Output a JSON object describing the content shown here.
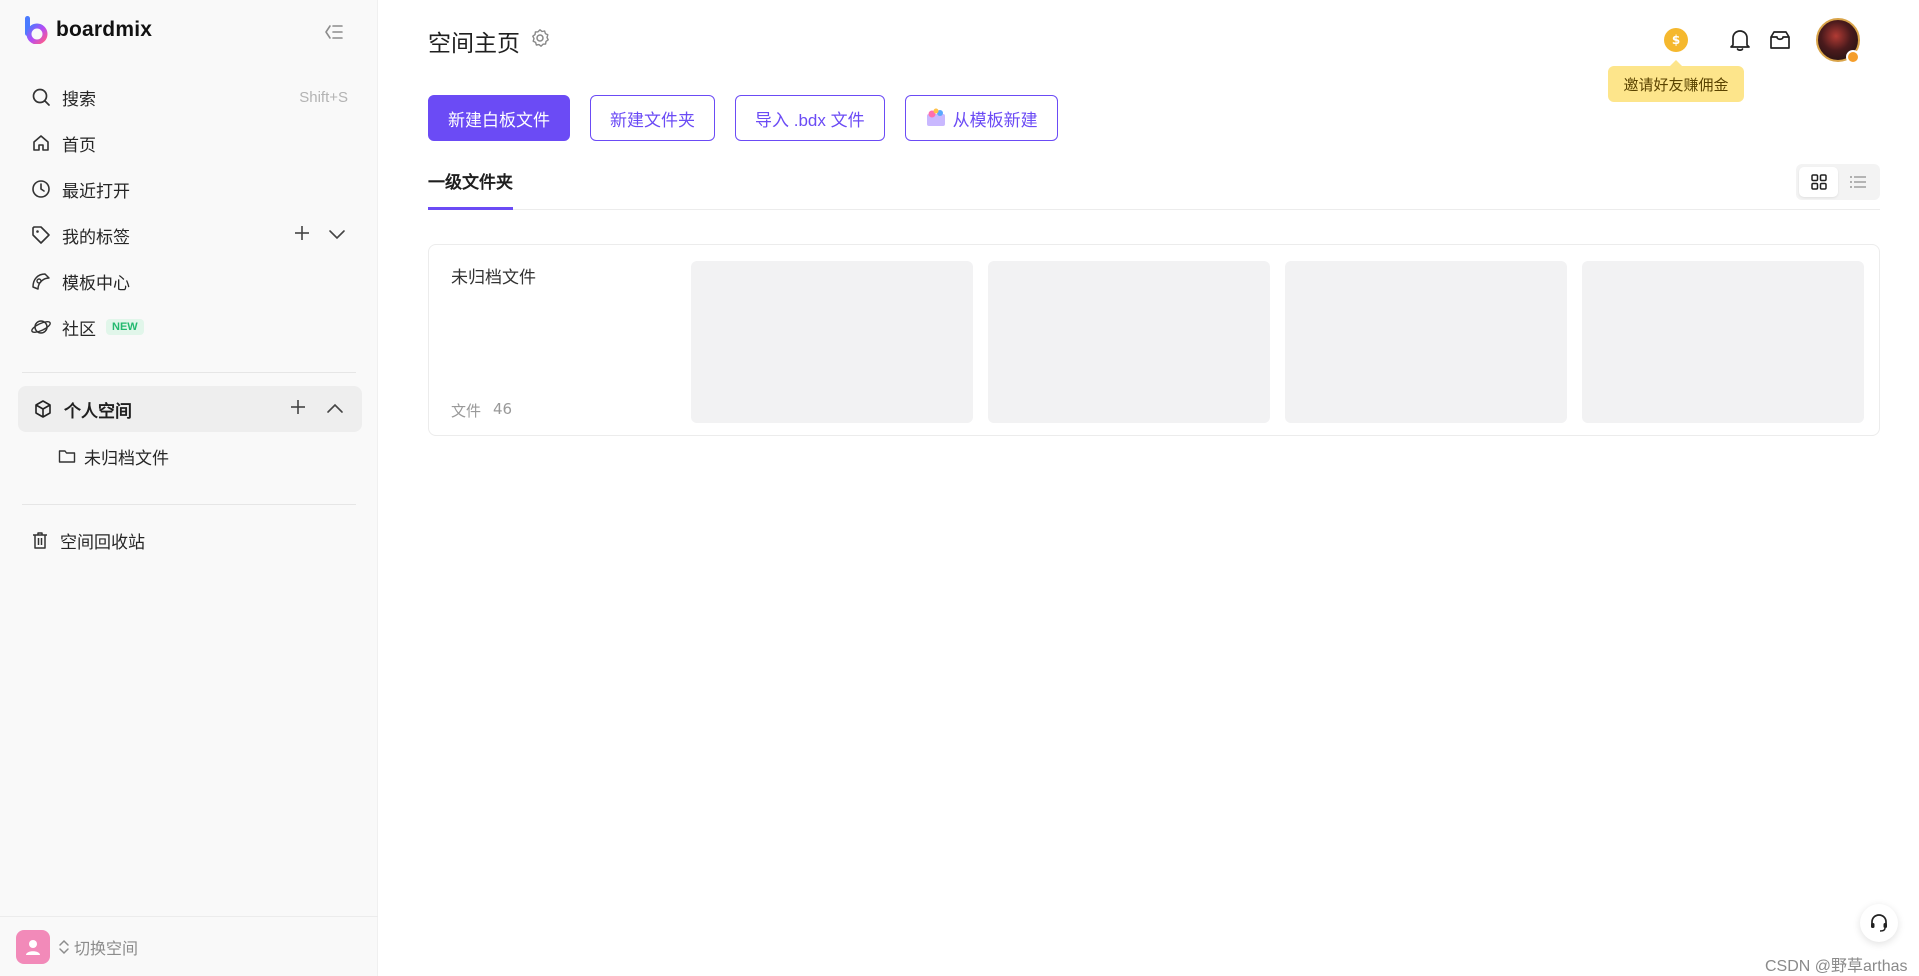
{
  "app": {
    "name": "boardmix",
    "brand_color": "#6b4bf5"
  },
  "sidebar": {
    "search": {
      "label": "搜索",
      "shortcut": "Shift+S"
    },
    "items": [
      {
        "label": "首页",
        "icon": "home-icon"
      },
      {
        "label": "最近打开",
        "icon": "clock-icon"
      },
      {
        "label": "我的标签",
        "icon": "tag-icon"
      },
      {
        "label": "模板中心",
        "icon": "template-icon"
      },
      {
        "label": "社区",
        "icon": "planet-icon",
        "badge": "NEW"
      }
    ],
    "space": {
      "label": "个人空间",
      "folders": [
        {
          "label": "未归档文件"
        }
      ]
    },
    "trash": {
      "label": "空间回收站"
    },
    "switch_space": {
      "label": "切换空间"
    }
  },
  "header": {
    "title": "空间主页",
    "coin_glyph": "$",
    "invite_tooltip": "邀请好友赚佣金"
  },
  "actions": {
    "new_board": "新建白板文件",
    "new_folder": "新建文件夹",
    "import_bdx": "导入 .bdx 文件",
    "from_template": "从模板新建"
  },
  "tabs": [
    {
      "label": "一级文件夹",
      "active": true
    }
  ],
  "view_mode": "grid",
  "folders": [
    {
      "name": "未归档文件",
      "count_label": "文件",
      "count": "46"
    }
  ],
  "watermark": "CSDN @野草arthas"
}
